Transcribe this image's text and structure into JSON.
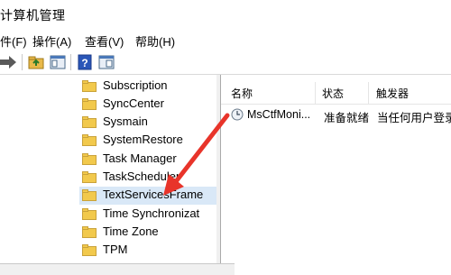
{
  "window": {
    "title": "计算机管理"
  },
  "menu": [
    {
      "label": "件(F)"
    },
    {
      "label": "操作(A)"
    },
    {
      "label": "查看(V)"
    },
    {
      "label": "帮助(H)"
    }
  ],
  "toolbar": {
    "icons": [
      "forward-arrow-icon",
      "up-folder-icon",
      "show-hide-tree-icon",
      "help-icon",
      "properties-pane-icon"
    ]
  },
  "tree": {
    "items": [
      {
        "label": "Subscription"
      },
      {
        "label": "SyncCenter"
      },
      {
        "label": "Sysmain"
      },
      {
        "label": "SystemRestore"
      },
      {
        "label": "Task Manager"
      },
      {
        "label": "TaskScheduler"
      },
      {
        "label": "TextServicesFrame",
        "selected": true
      },
      {
        "label": "Time Synchronizat"
      },
      {
        "label": "Time Zone"
      },
      {
        "label": "TPM"
      }
    ]
  },
  "list": {
    "columns": [
      "名称",
      "状态",
      "触发器"
    ],
    "rows": [
      {
        "name": "MsCtfMoni...",
        "status": "准备就绪",
        "trigger": "当任何用户登录"
      }
    ]
  },
  "colors": {
    "selected_row": "#d9e8f7",
    "arrow": "#e8342a",
    "folder": "#f2c94c"
  }
}
